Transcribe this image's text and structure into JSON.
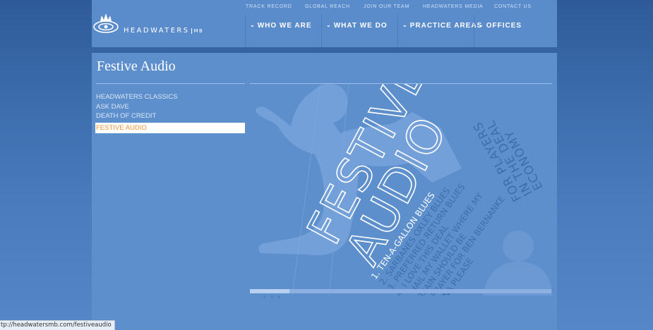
{
  "brand": {
    "name": "HEADWATERS",
    "suffix": "MB"
  },
  "utility_links": [
    "TRACK RECORD",
    "GLOBAL REACH",
    "JOIN OUR TEAM",
    "HEADWATERS MEDIA",
    "CONTACT US"
  ],
  "main_nav": [
    "WHO WE ARE",
    "WHAT WE DO",
    "PRACTICE AREAS",
    "OFFICES"
  ],
  "page": {
    "title": "Festive Audio"
  },
  "subnav": [
    "HEADWATERS CLASSICS",
    "ASK DAVE",
    "DEATH OF CREDIT",
    "FESTIVE AUDIO"
  ],
  "subnav_active": "FESTIVE AUDIO",
  "artwork": {
    "headline1": "FESTIVE",
    "headline2": "AUDIO",
    "tagline1": "FOR PLAYERS",
    "tagline2": "IN THE DEAL",
    "tagline3": "ECONOMY",
    "tracks": [
      "1. TEN-A-GALLON BLUES",
      "2. SARBANES OXLEY BLUES",
      "3. PREFERRED RETURN BLUES",
      "4. I LOVE THIS DEAL",
      "5. HAIL MY WALLET WHERE MY",
      "BRAIN SHOULD BE",
      "6. A PRAYER FOR BEN BERNANKE",
      "7. CHINA PLEASE"
    ]
  },
  "player": {
    "progress": 0.13,
    "controls": "« ॥ »"
  },
  "status_bar": {
    "url": "tp://headwatersmb.com/festiveaudio"
  },
  "colors": {
    "accent": "#e89437",
    "header_bg": "#5a8ccb",
    "content_bg": "#5d8fcd"
  }
}
